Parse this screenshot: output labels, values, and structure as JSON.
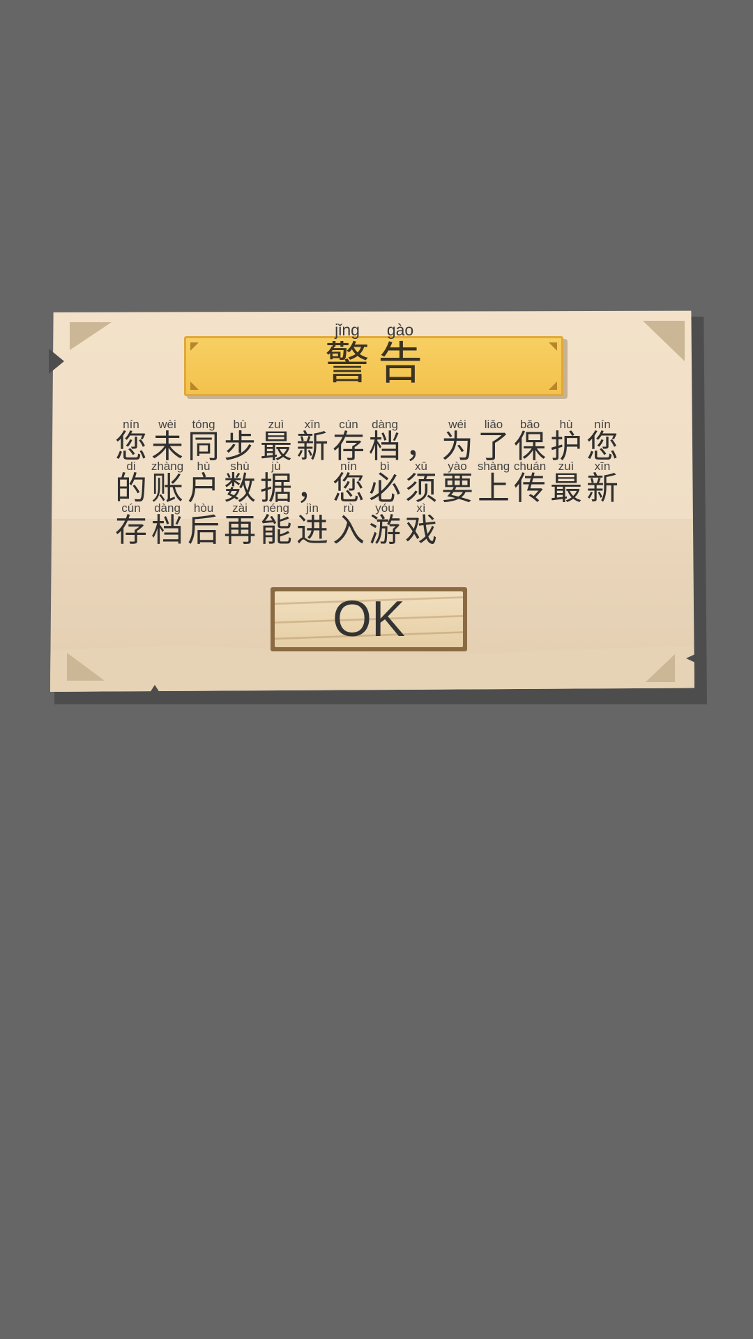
{
  "dialog": {
    "title": {
      "chars": [
        {
          "py": "jǐng",
          "hz": "警"
        },
        {
          "py": "gào",
          "hz": "告"
        }
      ]
    },
    "message": {
      "rows": [
        [
          {
            "py": "nín",
            "hz": "您"
          },
          {
            "py": "wèi",
            "hz": "未"
          },
          {
            "py": "tóng",
            "hz": "同"
          },
          {
            "py": "bù",
            "hz": "步"
          },
          {
            "py": "zuì",
            "hz": "最"
          },
          {
            "py": "xīn",
            "hz": "新"
          },
          {
            "py": "cún",
            "hz": "存"
          },
          {
            "py": "dàng",
            "hz": "档"
          },
          {
            "py": "",
            "hz": "，"
          },
          {
            "py": "wéi",
            "hz": "为"
          },
          {
            "py": "liǎo",
            "hz": "了"
          },
          {
            "py": "bǎo",
            "hz": "保"
          },
          {
            "py": "hù",
            "hz": "护"
          },
          {
            "py": "nín",
            "hz": "您"
          }
        ],
        [
          {
            "py": "di",
            "hz": "的"
          },
          {
            "py": "zhàng",
            "hz": "账"
          },
          {
            "py": "hù",
            "hz": "户"
          },
          {
            "py": "shù",
            "hz": "数"
          },
          {
            "py": "jù",
            "hz": "据"
          },
          {
            "py": "",
            "hz": "，"
          },
          {
            "py": "nín",
            "hz": "您"
          },
          {
            "py": "bì",
            "hz": "必"
          },
          {
            "py": "xū",
            "hz": "须"
          },
          {
            "py": "yào",
            "hz": "要"
          },
          {
            "py": "shàng",
            "hz": "上"
          },
          {
            "py": "chuán",
            "hz": "传"
          },
          {
            "py": "zuì",
            "hz": "最"
          },
          {
            "py": "xīn",
            "hz": "新"
          }
        ],
        [
          {
            "py": "cún",
            "hz": "存"
          },
          {
            "py": "dàng",
            "hz": "档"
          },
          {
            "py": "hòu",
            "hz": "后"
          },
          {
            "py": "zài",
            "hz": "再"
          },
          {
            "py": "néng",
            "hz": "能"
          },
          {
            "py": "jìn",
            "hz": "进"
          },
          {
            "py": "rù",
            "hz": "入"
          },
          {
            "py": "yóu",
            "hz": "游"
          },
          {
            "py": "xì",
            "hz": "戏"
          }
        ]
      ]
    },
    "ok_label": "OK"
  },
  "colors": {
    "background": "#666666",
    "parchment": "#f3e2c9",
    "banner": "#f5c855",
    "text": "#2f2f2f"
  }
}
